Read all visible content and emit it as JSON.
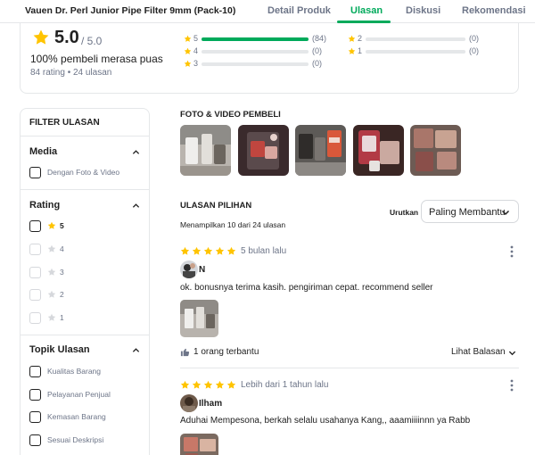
{
  "header": {
    "product_title": "Vauen Dr. Perl Junior Pipe Filter 9mm (Pack-10)",
    "tabs": [
      {
        "label": "Detail Produk",
        "active": false
      },
      {
        "label": "Ulasan",
        "active": true
      },
      {
        "label": "Diskusi",
        "active": false
      },
      {
        "label": "Rekomendasi",
        "active": false
      }
    ]
  },
  "summary": {
    "average": "5.0",
    "out_of": "/ 5.0",
    "satisfied": "100% pembeli merasa puas",
    "meta": "84 rating • 24 ulasan",
    "distribution": [
      {
        "star": "5",
        "count": "(84)",
        "fraction": 1.0
      },
      {
        "star": "4",
        "count": "(0)",
        "fraction": 0
      },
      {
        "star": "3",
        "count": "(0)",
        "fraction": 0
      },
      {
        "star": "2",
        "count": "(0)",
        "fraction": 0
      },
      {
        "star": "1",
        "count": "(0)",
        "fraction": 0
      }
    ]
  },
  "filter": {
    "title": "FILTER ULASAN",
    "media": {
      "title": "Media",
      "options": [
        "Dengan Foto & Video"
      ]
    },
    "rating": {
      "title": "Rating",
      "options": [
        "5",
        "4",
        "3",
        "2",
        "1"
      ]
    },
    "topics": {
      "title": "Topik Ulasan",
      "options": [
        "Kualitas Barang",
        "Pelayanan Penjual",
        "Kemasan Barang",
        "Sesuai Deskripsi"
      ]
    }
  },
  "media_section": {
    "title": "FOTO & VIDEO PEMBELI"
  },
  "reviews_section": {
    "title": "ULASAN PILIHAN",
    "showing": "Menampilkan 10 dari 24 ulasan",
    "sort_label": "Urutkan",
    "sort_value": "Paling Membantu"
  },
  "reviews": [
    {
      "stars": 5,
      "time": "5 bulan lalu",
      "name": "N",
      "text": "ok. bonusnya terima kasih. pengiriman cepat. recommend seller",
      "helpful": "1 orang terbantu",
      "reply": "Lihat Balasan"
    },
    {
      "stars": 5,
      "time": "Lebih dari 1 tahun lalu",
      "name": "Ilham",
      "text": "Aduhai Mempesona, berkah selalu usahanya Kang,, aaamiiiinnn ya Rabb"
    }
  ],
  "colors": {
    "accent": "#00aa5b",
    "star": "#ffc400",
    "star_dim": "#d6d8dc"
  }
}
